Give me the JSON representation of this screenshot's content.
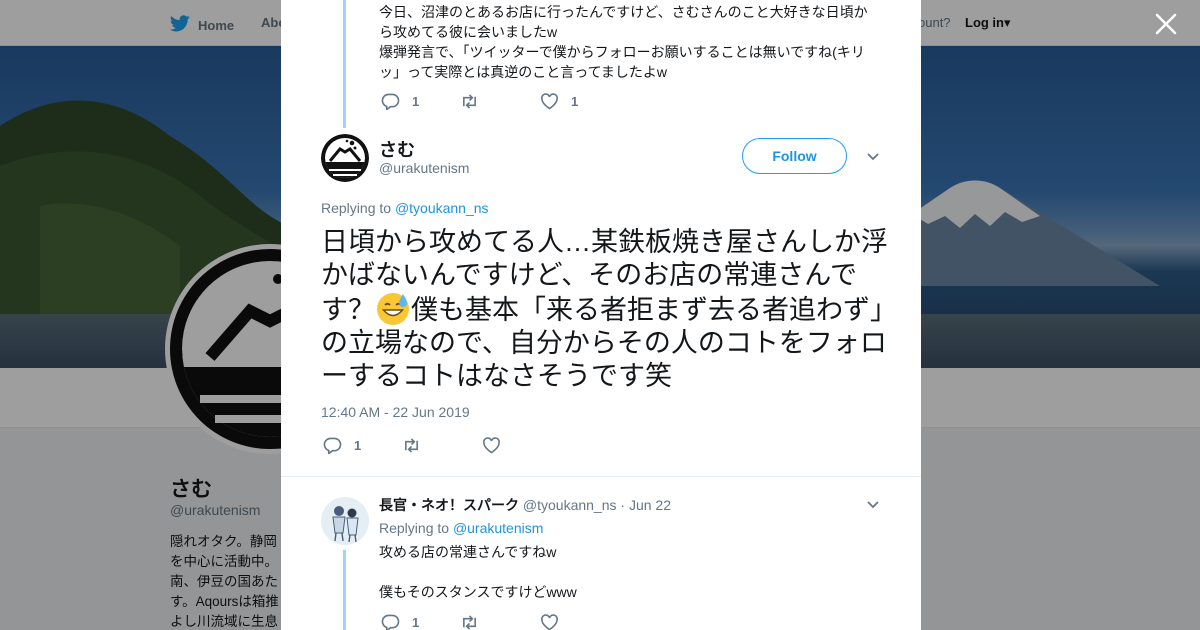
{
  "nav": {
    "home": "Home",
    "about": "Abo",
    "account": "ccount?",
    "login": "Log in"
  },
  "profile": {
    "name": "さむ",
    "handle": "@urakutenism",
    "bio_lines": [
      "隠れオタク。静岡",
      "を中心に活動中。",
      "南、伊豆の国あた",
      "す。Aqoursは箱推",
      "よし川流域に生息"
    ]
  },
  "prev_tweet": {
    "line1": "今日、沼津のとあるお店に行ったんですけど、さむさんのこと大好きな日頃か",
    "line2": "ら攻めてる彼に会いましたw",
    "line3": "爆弾発言で、「ツイッターで僕からフォローお願いすることは無いですね(キリ",
    "line4": "ッ」って実際とは真逆のこと言ってましたよw",
    "replies": "1",
    "likes": "1"
  },
  "main_tweet": {
    "name": "さむ",
    "handle": "@urakutenism",
    "follow_label": "Follow",
    "replying_prefix": "Replying to",
    "replying_to": "@tyoukann_ns",
    "text_before_emoji": "日頃から攻めてる人…某鉄板焼き屋さんしか浮かばないんですけど、そのお店の常連さんです？",
    "emoji": "grinning-sweat-emoji",
    "text_after_emoji": "僕も基本「来る者拒まず去る者追わず」の立場なので、自分からその人のコトをフォローするコトはなさそうです笑",
    "timestamp": "12:40 AM - 22 Jun 2019",
    "replies": "1"
  },
  "reply_tweet": {
    "name": "長官・ネオ！スパーク",
    "handle": "@tyoukann_ns",
    "date": "· Jun 22",
    "replying_prefix": "Replying to",
    "replying_to": "@urakutenism",
    "line1": "攻める店の常連さんですねw",
    "line2": "僕もそのスタンスですけどwww",
    "replies": "1"
  },
  "colors": {
    "accent": "#1da1f2",
    "link": "#1b95e0",
    "muted": "#657786",
    "thread_line": "#9fd4f4"
  }
}
